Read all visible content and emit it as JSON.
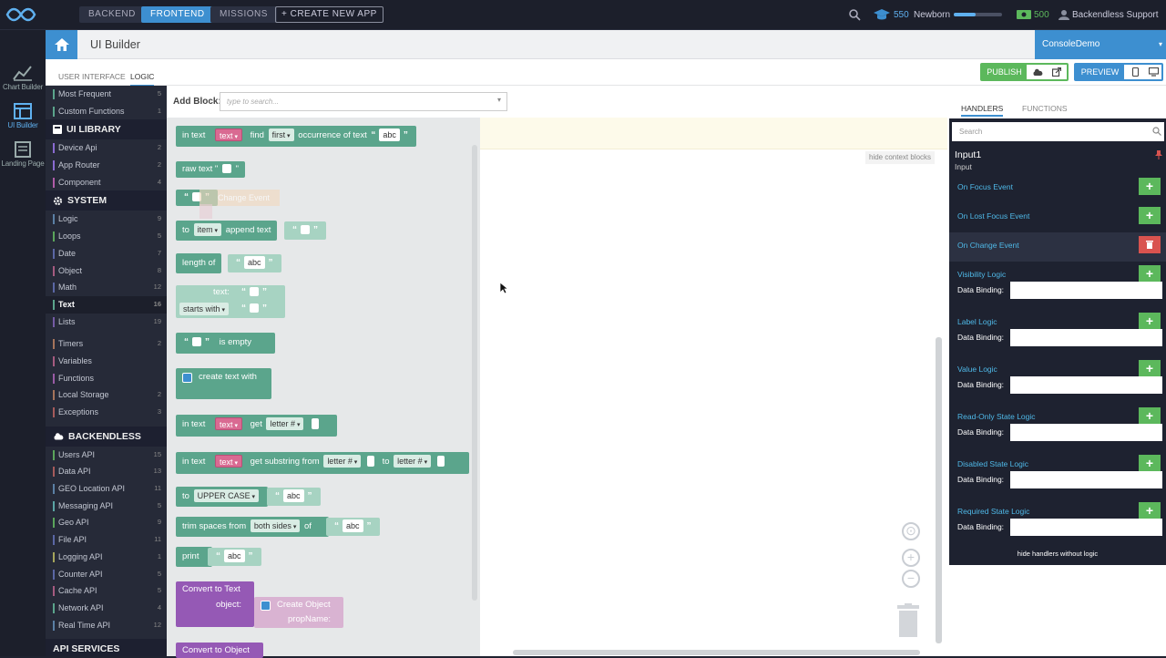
{
  "topbar": {
    "tabs": [
      "BACKEND",
      "FRONTEND",
      "MISSIONS"
    ],
    "active_tab": "FRONTEND",
    "create_app": "+ CREATE NEW APP",
    "points": "550",
    "rank": "Newborn",
    "credits": "500",
    "user": "Backendless Support"
  },
  "rail": {
    "chart_builder": "Chart Builder",
    "ui_builder": "UI Builder",
    "landing_page": "Landing Page"
  },
  "header": {
    "title": "UI Builder",
    "app_selector": "ConsoleDemo"
  },
  "subnav": {
    "tab_ui": "USER INTERFACE",
    "tab_logic": "LOGIC",
    "publish": "PUBLISH",
    "preview": "PREVIEW"
  },
  "addblock": {
    "label": "Add Block:",
    "placeholder": "type to search..."
  },
  "sidebar": {
    "top": [
      {
        "label": "Most Frequent",
        "count": "5",
        "color": "#5ba58c"
      },
      {
        "label": "Custom Functions",
        "count": "1",
        "color": "#5ba58c"
      }
    ],
    "ui_library": {
      "title": "UI LIBRARY",
      "items": [
        {
          "label": "Device Api",
          "count": "2",
          "color": "#8a6bd1"
        },
        {
          "label": "App Router",
          "count": "2",
          "color": "#8a6bd1"
        },
        {
          "label": "Component",
          "count": "4",
          "color": "#b05ca8"
        }
      ]
    },
    "system": {
      "title": "SYSTEM",
      "items": [
        {
          "label": "Logic",
          "count": "9",
          "color": "#5b80a5"
        },
        {
          "label": "Loops",
          "count": "5",
          "color": "#5ba55b"
        },
        {
          "label": "Date",
          "count": "7",
          "color": "#5b67a5"
        },
        {
          "label": "Object",
          "count": "8",
          "color": "#a55b80"
        },
        {
          "label": "Math",
          "count": "12",
          "color": "#5b67a5"
        },
        {
          "label": "Text",
          "count": "16",
          "color": "#5ba58c"
        },
        {
          "label": "Lists",
          "count": "19",
          "color": "#745ba5"
        }
      ],
      "items2": [
        {
          "label": "Timers",
          "count": "2",
          "color": "#a5745b"
        },
        {
          "label": "Variables",
          "count": "",
          "color": "#a55b80"
        },
        {
          "label": "Functions",
          "count": "",
          "color": "#995ba5"
        },
        {
          "label": "Local Storage",
          "count": "2",
          "color": "#a5745b"
        },
        {
          "label": "Exceptions",
          "count": "3",
          "color": "#a55b5b"
        }
      ]
    },
    "backendless": {
      "title": "BACKENDLESS",
      "items": [
        {
          "label": "Users API",
          "count": "15",
          "color": "#5ba55b"
        },
        {
          "label": "Data API",
          "count": "13",
          "color": "#a55b5b"
        },
        {
          "label": "GEO Location API",
          "count": "11",
          "color": "#5b80a5"
        },
        {
          "label": "Messaging API",
          "count": "5",
          "color": "#5ba5a5"
        },
        {
          "label": "Geo API",
          "count": "9",
          "color": "#5ba55b"
        },
        {
          "label": "File API",
          "count": "11",
          "color": "#5b67a5"
        },
        {
          "label": "Logging API",
          "count": "1",
          "color": "#a5a55b"
        },
        {
          "label": "Counter API",
          "count": "5",
          "color": "#5b67a5"
        },
        {
          "label": "Cache API",
          "count": "5",
          "color": "#a55b80"
        },
        {
          "label": "Network API",
          "count": "4",
          "color": "#5ba58c"
        },
        {
          "label": "Real Time API",
          "count": "12",
          "color": "#5b80a5"
        }
      ]
    },
    "api_services": "API SERVICES"
  },
  "blocks": {
    "b1": {
      "a": "in text",
      "b": "text",
      "c": "find",
      "d": "first",
      "e": "occurrence of text",
      "f": "abc"
    },
    "b2": {
      "a": "raw text \""
    },
    "b3": {
      "ghost": "Change Event"
    },
    "b4": {
      "a": "to",
      "b": "item",
      "c": "append text"
    },
    "b5": {
      "a": "length of",
      "b": "abc"
    },
    "b6": {
      "a": "text:",
      "b": "starts with"
    },
    "b7": {
      "a": "is empty"
    },
    "b8": {
      "a": "create text with"
    },
    "b9": {
      "a": "in text",
      "b": "text",
      "c": "get",
      "d": "letter #"
    },
    "b10": {
      "a": "in text",
      "b": "text",
      "c": "get substring from",
      "d": "letter #",
      "e": "to",
      "f": "letter #"
    },
    "b11": {
      "a": "to",
      "b": "UPPER CASE",
      "c": "abc"
    },
    "b12": {
      "a": "trim spaces from",
      "b": "both sides",
      "c": "of",
      "d": "abc"
    },
    "b13": {
      "a": "print",
      "b": "abc"
    },
    "b14": {
      "a": "Convert to Text",
      "b": "object:",
      "c": "Create Object",
      "d": "propName:"
    },
    "b15": {
      "a": "Convert to Object"
    }
  },
  "canvas": {
    "hide_context": "hide context blocks"
  },
  "handlers": {
    "tab_handlers": "HANDLERS",
    "tab_functions": "FUNCTIONS",
    "search_placeholder": "Search",
    "component_name": "Input1",
    "component_type": "Input",
    "data_binding_label": "Data Binding:",
    "items": [
      {
        "label": "On Focus Event",
        "active": false
      },
      {
        "label": "On Lost Focus Event",
        "active": false
      },
      {
        "label": "On Change Event",
        "active": true
      },
      {
        "label": "Visibility Logic",
        "active": false
      },
      {
        "label": "Label Logic",
        "active": false
      },
      {
        "label": "Value Logic",
        "active": false
      },
      {
        "label": "Read-Only State Logic",
        "active": false
      },
      {
        "label": "Disabled State Logic",
        "active": false
      },
      {
        "label": "Required State Logic",
        "active": false
      }
    ],
    "hide_without_logic": "hide handlers without logic"
  }
}
